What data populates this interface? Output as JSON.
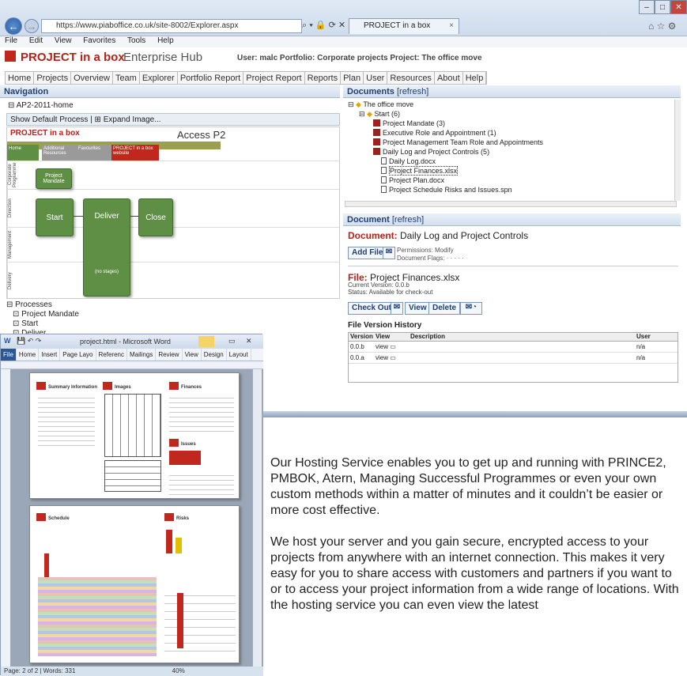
{
  "browser": {
    "url": "https://www.piaboffice.co.uk/site-8002/Explorer.aspx",
    "tab_title": "PROJECT in a box",
    "menu": [
      "File",
      "Edit",
      "View",
      "Favorites",
      "Tools",
      "Help"
    ]
  },
  "app": {
    "logo": "PROJECT in a box",
    "logo_sub": "Enterprise Hub",
    "user_info": "User: malc Portfolio: Corporate projects Project: The office move",
    "tabs": [
      "Home",
      "Projects",
      "Overview",
      "Team",
      "Explorer",
      "Portfolio Report",
      "Project Report",
      "Reports",
      "Plan",
      "User",
      "Resources",
      "About",
      "Help"
    ]
  },
  "navigation": {
    "title": "Navigation",
    "root": "AP2-2011-home",
    "show_default": "Show Default Process",
    "expand_image": "Expand Image...",
    "diagram": {
      "logo": "PROJECT in a box",
      "title": "Access P2",
      "tabs": [
        "Home",
        "Additional Resources",
        "Favourites",
        "PROJECT in a box website"
      ],
      "lanes": [
        "Corporate Programme",
        "Direction",
        "Management",
        "Delivery"
      ],
      "boxes": [
        "Project Mandate",
        "Start",
        "Deliver",
        "Close",
        "(no stages)"
      ]
    },
    "processes": [
      "Processes",
      "Project Mandate",
      "Start",
      "Deliver"
    ]
  },
  "documents": {
    "title": "Documents",
    "refresh": "[refresh]",
    "tree": [
      {
        "label": "The office move",
        "kind": "root"
      },
      {
        "label": "Start (6)",
        "kind": "folder"
      },
      {
        "label": "Project Mandate (3)",
        "kind": "doc"
      },
      {
        "label": "Executive Role and Appointment (1)",
        "kind": "doc"
      },
      {
        "label": "Project Management Team Role and Appointments",
        "kind": "doc"
      },
      {
        "label": "Daily Log and Project Controls (5)",
        "kind": "doc"
      },
      {
        "label": "Daily Log.docx",
        "kind": "file"
      },
      {
        "label": "Project Finances.xlsx",
        "kind": "file"
      },
      {
        "label": "Project Plan.docx",
        "kind": "file"
      },
      {
        "label": "Project Schedule Risks and Issues.spn",
        "kind": "file"
      }
    ]
  },
  "document": {
    "title": "Document",
    "refresh": "[refresh]",
    "label": "Document:",
    "name": "Daily Log and Project Controls",
    "add_file": "Add File",
    "permissions": "Permissions:  Modify",
    "flags": "Document Flags:  · · · · ·",
    "file_label": "File:",
    "file_name": "Project Finances.xlsx",
    "current_version": "Current Version:  0.0.b",
    "status": "Status:  Available for check-out",
    "check_out": "Check Out",
    "view": "View",
    "delete": "Delete",
    "history_title": "File Version History",
    "history_cols": [
      "Version",
      "View",
      "Description",
      "User"
    ],
    "history_rows": [
      {
        "version": "0.0.b",
        "view": "view",
        "desc": "",
        "user": "n/a"
      },
      {
        "version": "0.0.a",
        "view": "view",
        "desc": "",
        "user": "n/a"
      }
    ]
  },
  "word": {
    "title": "project.html - Microsoft Word",
    "tabs": [
      "File",
      "Home",
      "Insert",
      "Page Layo",
      "Referenc",
      "Mailings",
      "Review",
      "View",
      "Design",
      "Layout"
    ],
    "status": "Page: 2 of 2  |  Words: 331",
    "zoom": "40%",
    "sections": [
      "Summary Information",
      "Images",
      "Finances",
      "Issues",
      "Schedule",
      "Risks"
    ]
  },
  "body": {
    "p1": "Our Hosting Service enables you to get up and running with PRINCE2, PMBOK, Atern, Managing Successful Programmes or even your own custom methods within a matter of minutes and it couldn’t be easier or more cost effective.",
    "p2": "We host your server and you gain secure, encrypted access to your projects from anywhere with an internet connection.  This makes it very easy for you to share access with customers and partners if you want to or to access your project information from a wide range of locations.  With the hosting service you can even view the latest"
  },
  "colors": {
    "brand_red": "#c0281d",
    "process_green": "#5f8f44",
    "link_blue": "#1f3f72"
  }
}
